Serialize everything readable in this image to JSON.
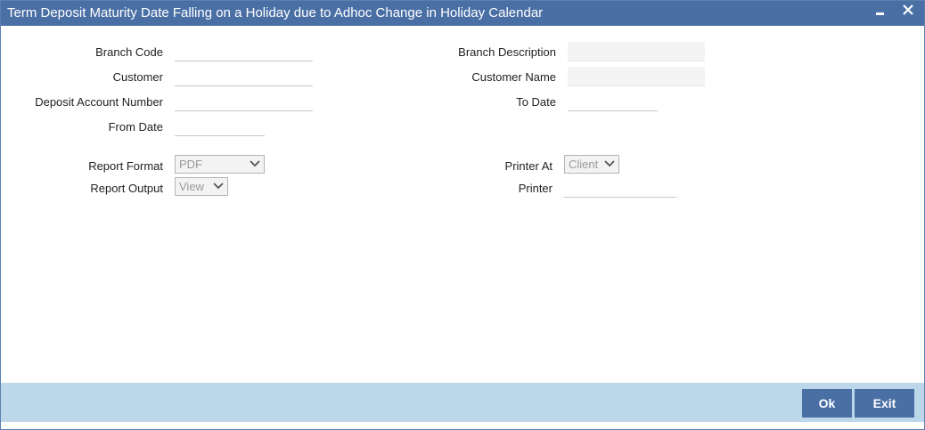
{
  "window": {
    "title": "Term Deposit Maturity Date Falling on a Holiday due to Adhoc Change in Holiday Calendar"
  },
  "form": {
    "branch_code": {
      "label": "Branch Code",
      "value": ""
    },
    "customer": {
      "label": "Customer",
      "value": ""
    },
    "deposit_account_number": {
      "label": "Deposit Account Number",
      "value": ""
    },
    "from_date": {
      "label": "From Date",
      "value": ""
    },
    "branch_description": {
      "label": "Branch Description",
      "value": ""
    },
    "customer_name": {
      "label": "Customer Name",
      "value": ""
    },
    "to_date": {
      "label": "To Date",
      "value": ""
    },
    "report_format": {
      "label": "Report Format",
      "selected": "PDF"
    },
    "report_output": {
      "label": "Report Output",
      "selected": "View"
    },
    "printer_at": {
      "label": "Printer At",
      "selected": "Client"
    },
    "printer": {
      "label": "Printer",
      "value": ""
    }
  },
  "footer": {
    "ok_label": "Ok",
    "exit_label": "Exit"
  },
  "colors": {
    "titlebar": "#4a6fa5",
    "footer": "#bcd6ea",
    "button": "#4a6fa5"
  },
  "icons": {
    "minimize": "minimize-icon",
    "close": "close-icon",
    "dropdown": "chevron-down-icon"
  }
}
